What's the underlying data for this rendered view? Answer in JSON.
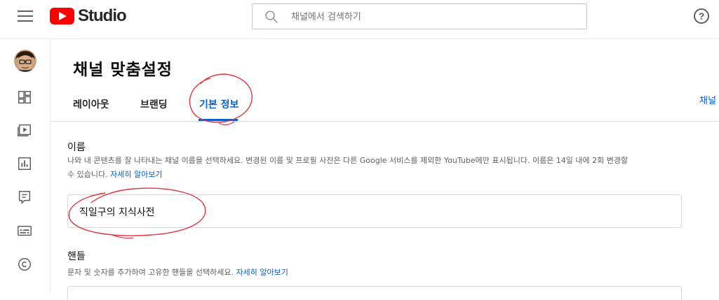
{
  "topbar": {
    "logo_text": "Studio",
    "search_placeholder": "채널에서 검색하기",
    "help_glyph": "?"
  },
  "page": {
    "title": "채널 맞춤설정",
    "tabs": [
      {
        "label": "레이아웃",
        "active": false
      },
      {
        "label": "브랜딩",
        "active": false
      },
      {
        "label": "기본 정보",
        "active": true
      }
    ],
    "right_link": "채널"
  },
  "name_section": {
    "title": "이름",
    "desc_line1": "나와 내 콘텐츠를 잘 나타내는 채널 이름을 선택하세요. 변경된 이름 및 프로필 사진은 다른 Google 서비스를 제외한 YouTube에만 표시됩니다. 이름은 14일 내에 2회 변경할",
    "desc_line2": "수 있습니다.",
    "learn_more": "자세히 알아보기",
    "value": "직일구의 지식사전"
  },
  "handle_section": {
    "title": "핸들",
    "desc": "문자 및 숫자를 추가하여 고유한 핸들을 선택하세요.",
    "learn_more": "자세히 알아보기"
  },
  "nav_icons": [
    "avatar",
    "dashboard-icon",
    "content-icon",
    "analytics-icon",
    "comments-icon",
    "subtitles-icon",
    "copyright-icon"
  ],
  "colors": {
    "accent": "#065fd4",
    "brand": "#ff0000",
    "annotation": "#e0353f"
  }
}
